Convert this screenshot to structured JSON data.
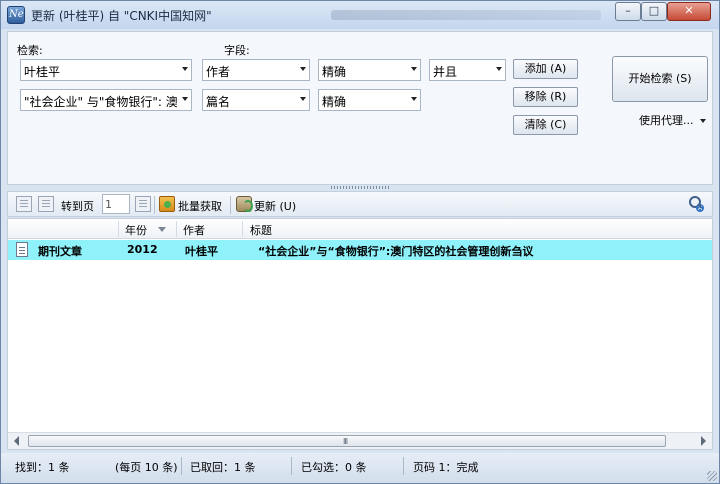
{
  "window": {
    "title": "更新 (叶桂平) 自 \"CNKI中国知网\"",
    "minimize": "–",
    "maximize": "□",
    "close": "✕"
  },
  "search": {
    "query_label": "检索:",
    "field_label": "字段:",
    "rows": [
      {
        "query": "叶桂平",
        "field": "作者",
        "match": "精确",
        "op": "并且"
      },
      {
        "query": "\"社会企业\" 与\"食物银行\": 澳",
        "field": "篇名",
        "match": "精确"
      }
    ],
    "add_label": "添加 (A)",
    "remove_label": "移除 (R)",
    "clear_label": "清除 (C)",
    "start_label": "开始检索 (S)",
    "proxy_label": "使用代理..."
  },
  "toolbar": {
    "goto_label": "转到页",
    "page_value": "1",
    "batch_label": "批量获取",
    "update_label": "更新 (U)"
  },
  "grid": {
    "columns": [
      "年份",
      "作者",
      "标题"
    ],
    "rows": [
      {
        "type": "期刊文章",
        "year": "2012",
        "author": "叶桂平",
        "title": "“社会企业”与“食物银行”:澳门特区的社会管理创新刍议"
      }
    ],
    "scroll_grip": "III"
  },
  "status": {
    "found": "找到：1 条",
    "per_page": "(每页 10 条)",
    "fetched": "已取回：1 条",
    "checked": "已勾选：0 条",
    "page": "页码 1：完成"
  }
}
